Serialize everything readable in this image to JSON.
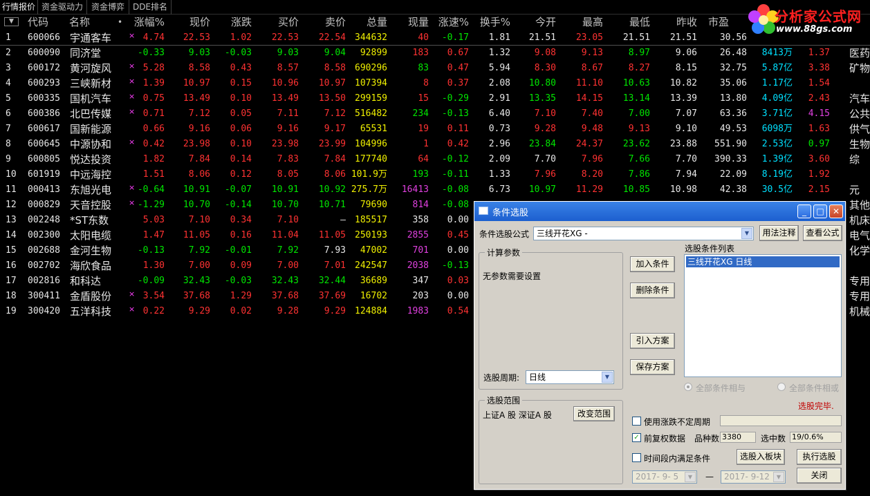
{
  "tabs": [
    "行情报价",
    "资金驱动力",
    "资金博弈",
    "DDE排名"
  ],
  "sort_button": "▼",
  "columns": [
    "代码",
    "名称",
    "•",
    "涨幅%",
    "现价",
    "涨跌",
    "买价",
    "卖价",
    "总量",
    "现量",
    "涨速%",
    "换手%",
    "今开",
    "最高",
    "最低",
    "昨收",
    "市盈"
  ],
  "logo": {
    "name": "分析家公式网",
    "url": "www.88gs.com"
  },
  "rows": [
    {
      "no": "1",
      "code": "600066",
      "name": "宇通客车",
      "mark": "×",
      "pct": "4.74",
      "price": "22.53",
      "chg": "1.02",
      "bid": "22.53",
      "ask": "22.54",
      "vol": "344632",
      "cur": "40",
      "spd": "-0.17",
      "turn": "1.81",
      "open": "21.51",
      "high": "23.05",
      "low": "21.51",
      "prev": "21.51",
      "pe": "30.56",
      "sel": true,
      "cls": {
        "pct": "c-red",
        "price": "c-red",
        "chg": "c-red",
        "bid": "c-red",
        "ask": "c-red",
        "cur": "c-red",
        "spd": "c-green",
        "open": "c-white",
        "high": "c-red",
        "low": "c-white"
      }
    },
    {
      "no": "2",
      "code": "600090",
      "name": "同济堂",
      "mark": "",
      "pct": "-0.33",
      "price": "9.03",
      "chg": "-0.03",
      "bid": "9.03",
      "ask": "9.04",
      "vol": "92899",
      "cur": "183",
      "spd": "0.67",
      "turn": "1.32",
      "open": "9.08",
      "high": "9.13",
      "low": "8.97",
      "prev": "9.06",
      "pe": "26.48",
      "cap": "8413万",
      "x": "1.37",
      "ind": "医药",
      "cls": {
        "pct": "c-green",
        "price": "c-green",
        "chg": "c-green",
        "bid": "c-green",
        "ask": "c-green",
        "cur": "c-red",
        "spd": "c-red",
        "open": "c-red",
        "high": "c-red",
        "low": "c-green"
      }
    },
    {
      "no": "3",
      "code": "600172",
      "name": "黄河旋风",
      "mark": "×",
      "pct": "5.28",
      "price": "8.58",
      "chg": "0.43",
      "bid": "8.57",
      "ask": "8.58",
      "vol": "690296",
      "cur": "83",
      "spd": "0.47",
      "turn": "5.94",
      "open": "8.30",
      "high": "8.67",
      "low": "8.27",
      "prev": "8.15",
      "pe": "32.75",
      "cap": "5.87亿",
      "x": "3.38",
      "ind": "矿物",
      "cls": {
        "pct": "c-red",
        "price": "c-red",
        "chg": "c-red",
        "bid": "c-red",
        "ask": "c-red",
        "cur": "c-green",
        "spd": "c-red",
        "open": "c-red",
        "high": "c-red",
        "low": "c-red"
      }
    },
    {
      "no": "4",
      "code": "600293",
      "name": "三峡新材",
      "mark": "×",
      "pct": "1.39",
      "price": "10.97",
      "chg": "0.15",
      "bid": "10.96",
      "ask": "10.97",
      "vol": "107394",
      "cur": "8",
      "spd": "0.37",
      "turn": "2.08",
      "open": "10.80",
      "high": "11.10",
      "low": "10.63",
      "prev": "10.82",
      "pe": "35.06",
      "cap": "1.17亿",
      "x": "1.54",
      "ind": "",
      "cls": {
        "pct": "c-red",
        "price": "c-red",
        "chg": "c-red",
        "bid": "c-red",
        "ask": "c-red",
        "cur": "c-red",
        "spd": "c-red",
        "open": "c-green",
        "high": "c-red",
        "low": "c-green"
      }
    },
    {
      "no": "5",
      "code": "600335",
      "name": "国机汽车",
      "mark": "×",
      "pct": "0.75",
      "price": "13.49",
      "chg": "0.10",
      "bid": "13.49",
      "ask": "13.50",
      "vol": "299159",
      "cur": "15",
      "spd": "-0.29",
      "turn": "2.91",
      "open": "13.35",
      "high": "14.15",
      "low": "13.14",
      "prev": "13.39",
      "pe": "13.80",
      "cap": "4.09亿",
      "x": "2.43",
      "ind": "汽车",
      "cls": {
        "pct": "c-red",
        "price": "c-red",
        "chg": "c-red",
        "bid": "c-red",
        "ask": "c-red",
        "cur": "c-red",
        "spd": "c-green",
        "open": "c-green",
        "high": "c-red",
        "low": "c-green"
      }
    },
    {
      "no": "6",
      "code": "600386",
      "name": "北巴传媒",
      "mark": "×",
      "pct": "0.71",
      "price": "7.12",
      "chg": "0.05",
      "bid": "7.11",
      "ask": "7.12",
      "vol": "516482",
      "cur": "234",
      "spd": "-0.13",
      "turn": "6.40",
      "open": "7.10",
      "high": "7.40",
      "low": "7.00",
      "prev": "7.07",
      "pe": "63.36",
      "cap": "3.71亿",
      "x": "4.15",
      "ind": "公共",
      "namecls": "c-cyan",
      "xcls": "c-mag",
      "cls": {
        "pct": "c-red",
        "price": "c-red",
        "chg": "c-red",
        "bid": "c-red",
        "ask": "c-red",
        "cur": "c-green",
        "spd": "c-green",
        "open": "c-red",
        "high": "c-red",
        "low": "c-green"
      }
    },
    {
      "no": "7",
      "code": "600617",
      "name": "国新能源",
      "mark": "",
      "pct": "0.66",
      "price": "9.16",
      "chg": "0.06",
      "bid": "9.16",
      "ask": "9.17",
      "vol": "65531",
      "cur": "19",
      "spd": "0.11",
      "turn": "0.73",
      "open": "9.28",
      "high": "9.48",
      "low": "9.13",
      "prev": "9.10",
      "pe": "49.53",
      "cap": "6098万",
      "x": "1.63",
      "ind": "供气",
      "cls": {
        "pct": "c-red",
        "price": "c-red",
        "chg": "c-red",
        "bid": "c-red",
        "ask": "c-red",
        "cur": "c-red",
        "spd": "c-red",
        "open": "c-red",
        "high": "c-red",
        "low": "c-red"
      }
    },
    {
      "no": "8",
      "code": "600645",
      "name": "中源协和",
      "mark": "×",
      "pct": "0.42",
      "price": "23.98",
      "chg": "0.10",
      "bid": "23.98",
      "ask": "23.99",
      "vol": "104996",
      "cur": "1",
      "spd": "0.42",
      "turn": "2.96",
      "open": "23.84",
      "high": "24.37",
      "low": "23.62",
      "prev": "23.88",
      "pe": "551.90",
      "cap": "2.53亿",
      "x": "0.97",
      "ind": "生物",
      "xcls": "c-green",
      "cls": {
        "pct": "c-red",
        "price": "c-red",
        "chg": "c-red",
        "bid": "c-red",
        "ask": "c-red",
        "cur": "c-red",
        "spd": "c-red",
        "open": "c-green",
        "high": "c-red",
        "low": "c-green"
      }
    },
    {
      "no": "9",
      "code": "600805",
      "name": "悦达投资",
      "mark": "",
      "pct": "1.82",
      "price": "7.84",
      "chg": "0.14",
      "bid": "7.83",
      "ask": "7.84",
      "vol": "177740",
      "cur": "64",
      "spd": "-0.12",
      "turn": "2.09",
      "open": "7.70",
      "high": "7.96",
      "low": "7.66",
      "prev": "7.70",
      "pe": "390.33",
      "cap": "1.39亿",
      "x": "3.60",
      "ind": "综",
      "cls": {
        "pct": "c-red",
        "price": "c-red",
        "chg": "c-red",
        "bid": "c-red",
        "ask": "c-red",
        "cur": "c-red",
        "spd": "c-green",
        "open": "c-white",
        "high": "c-red",
        "low": "c-green"
      }
    },
    {
      "no": "10",
      "code": "601919",
      "name": "中远海控",
      "mark": "",
      "pct": "1.51",
      "price": "8.06",
      "chg": "0.12",
      "bid": "8.05",
      "ask": "8.06",
      "vol": "101.9万",
      "cur": "193",
      "spd": "-0.11",
      "turn": "1.33",
      "open": "7.96",
      "high": "8.20",
      "low": "7.86",
      "prev": "7.94",
      "pe": "22.09",
      "cap": "8.19亿",
      "x": "1.92",
      "ind": "",
      "cls": {
        "pct": "c-red",
        "price": "c-red",
        "chg": "c-red",
        "bid": "c-red",
        "ask": "c-red",
        "cur": "c-green",
        "spd": "c-green",
        "open": "c-red",
        "high": "c-red",
        "low": "c-green"
      }
    },
    {
      "no": "11",
      "code": "000413",
      "name": "东旭光电",
      "mark": "×",
      "pct": "-0.64",
      "price": "10.91",
      "chg": "-0.07",
      "bid": "10.91",
      "ask": "10.92",
      "vol": "275.7万",
      "cur": "16413",
      "spd": "-0.08",
      "turn": "6.73",
      "open": "10.97",
      "high": "11.29",
      "low": "10.85",
      "prev": "10.98",
      "pe": "42.38",
      "cap": "30.5亿",
      "x": "2.15",
      "ind": "元",
      "curcls": "c-mag",
      "cls": {
        "pct": "c-green",
        "price": "c-green",
        "chg": "c-green",
        "bid": "c-green",
        "ask": "c-green",
        "cur": "c-mag",
        "spd": "c-green",
        "open": "c-green",
        "high": "c-red",
        "low": "c-green"
      }
    },
    {
      "no": "12",
      "code": "000829",
      "name": "天音控股",
      "mark": "×",
      "pct": "-1.29",
      "price": "10.70",
      "chg": "-0.14",
      "bid": "10.70",
      "ask": "10.71",
      "vol": "79690",
      "cur": "814",
      "spd": "-0.08",
      "ind": "其他",
      "cls": {
        "pct": "c-green",
        "price": "c-green",
        "chg": "c-green",
        "bid": "c-green",
        "ask": "c-green",
        "cur": "c-mag",
        "spd": "c-green"
      }
    },
    {
      "no": "13",
      "code": "002248",
      "name": "*ST东数",
      "mark": "",
      "pct": "5.03",
      "price": "7.10",
      "chg": "0.34",
      "bid": "7.10",
      "ask": "—",
      "vol": "185517",
      "cur": "358",
      "spd": "0.00",
      "ind": "机床",
      "cls": {
        "pct": "c-red",
        "price": "c-red",
        "chg": "c-red",
        "bid": "c-red",
        "ask": "c-white",
        "cur": "c-white",
        "spd": "c-white"
      }
    },
    {
      "no": "14",
      "code": "002300",
      "name": "太阳电缆",
      "mark": "",
      "pct": "1.47",
      "price": "11.05",
      "chg": "0.16",
      "bid": "11.04",
      "ask": "11.05",
      "vol": "250193",
      "cur": "2855",
      "spd": "0.45",
      "ind": "电气",
      "cls": {
        "pct": "c-red",
        "price": "c-red",
        "chg": "c-red",
        "bid": "c-red",
        "ask": "c-red",
        "cur": "c-mag",
        "spd": "c-red"
      }
    },
    {
      "no": "15",
      "code": "002688",
      "name": "金河生物",
      "mark": "",
      "pct": "-0.13",
      "price": "7.92",
      "chg": "-0.01",
      "bid": "7.92",
      "ask": "7.93",
      "vol": "47002",
      "cur": "701",
      "spd": "0.00",
      "ind": "化学",
      "cls": {
        "pct": "c-green",
        "price": "c-green",
        "chg": "c-green",
        "bid": "c-green",
        "ask": "c-white",
        "cur": "c-mag",
        "spd": "c-white"
      }
    },
    {
      "no": "16",
      "code": "002702",
      "name": "海欣食品",
      "mark": "",
      "pct": "1.30",
      "price": "7.00",
      "chg": "0.09",
      "bid": "7.00",
      "ask": "7.01",
      "vol": "242547",
      "cur": "2038",
      "spd": "-0.13",
      "ind": "",
      "cls": {
        "pct": "c-red",
        "price": "c-red",
        "chg": "c-red",
        "bid": "c-red",
        "ask": "c-red",
        "cur": "c-mag",
        "spd": "c-green"
      }
    },
    {
      "no": "17",
      "code": "002816",
      "name": "和科达",
      "mark": "",
      "pct": "-0.09",
      "price": "32.43",
      "chg": "-0.03",
      "bid": "32.43",
      "ask": "32.44",
      "vol": "36689",
      "cur": "347",
      "spd": "0.03",
      "ind": "专用",
      "cls": {
        "pct": "c-green",
        "price": "c-green",
        "chg": "c-green",
        "bid": "c-green",
        "ask": "c-green",
        "cur": "c-white",
        "spd": "c-red"
      }
    },
    {
      "no": "18",
      "code": "300411",
      "name": "金盾股份",
      "mark": "×",
      "pct": "3.54",
      "price": "37.68",
      "chg": "1.29",
      "bid": "37.68",
      "ask": "37.69",
      "vol": "16702",
      "cur": "203",
      "spd": "0.00",
      "ind": "专用",
      "cls": {
        "pct": "c-red",
        "price": "c-red",
        "chg": "c-red",
        "bid": "c-red",
        "ask": "c-red",
        "cur": "c-white",
        "spd": "c-white"
      }
    },
    {
      "no": "19",
      "code": "300420",
      "name": "五洋科技",
      "mark": "×",
      "pct": "0.22",
      "price": "9.29",
      "chg": "0.02",
      "bid": "9.28",
      "ask": "9.29",
      "vol": "124884",
      "cur": "1983",
      "spd": "0.54",
      "ind": "机械",
      "cls": {
        "pct": "c-red",
        "price": "c-red",
        "chg": "c-red",
        "bid": "c-red",
        "ask": "c-red",
        "cur": "c-mag",
        "spd": "c-red"
      }
    }
  ],
  "dialog": {
    "title": "条件选股",
    "formula_label": "条件选股公式",
    "formula_value": "三线开花XG   -",
    "btn_usage": "用法注释",
    "btn_view": "查看公式",
    "calc_params_title": "计算参数",
    "no_params": "无参数需要设置",
    "period_label": "选股周期:",
    "period_value": "日线",
    "btn_add": "加入条件",
    "btn_delete": "删除条件",
    "btn_import": "引入方案",
    "btn_save": "保存方案",
    "cond_list_title": "选股条件列表",
    "cond_list_items": [
      "三线开花XG   日线"
    ],
    "radio_and": "全部条件相与",
    "radio_or": "全部条件相或",
    "status": "选股完毕.",
    "range_title": "选股范围",
    "range_value": "上证A 股  深证A 股",
    "btn_change_range": "改变范围",
    "chk_uncertain": "使用涨跌不定周期",
    "chk_uncertain_checked": false,
    "chk_adjust": "前复权数据",
    "chk_adjust_checked": true,
    "species_label": "品种数",
    "species_value": "3380",
    "selected_label": "选中数",
    "selected_value": "19/0.6%",
    "chk_timerange": "时间段内满足条件",
    "chk_timerange_checked": false,
    "btn_to_block": "选股入板块",
    "btn_execute": "执行选股",
    "date_from": "2017- 9- 5",
    "date_sep": "—",
    "date_to": "2017- 9-12",
    "btn_close": "关闭",
    "titlebar_buttons": [
      "_",
      "□",
      "✕"
    ]
  }
}
